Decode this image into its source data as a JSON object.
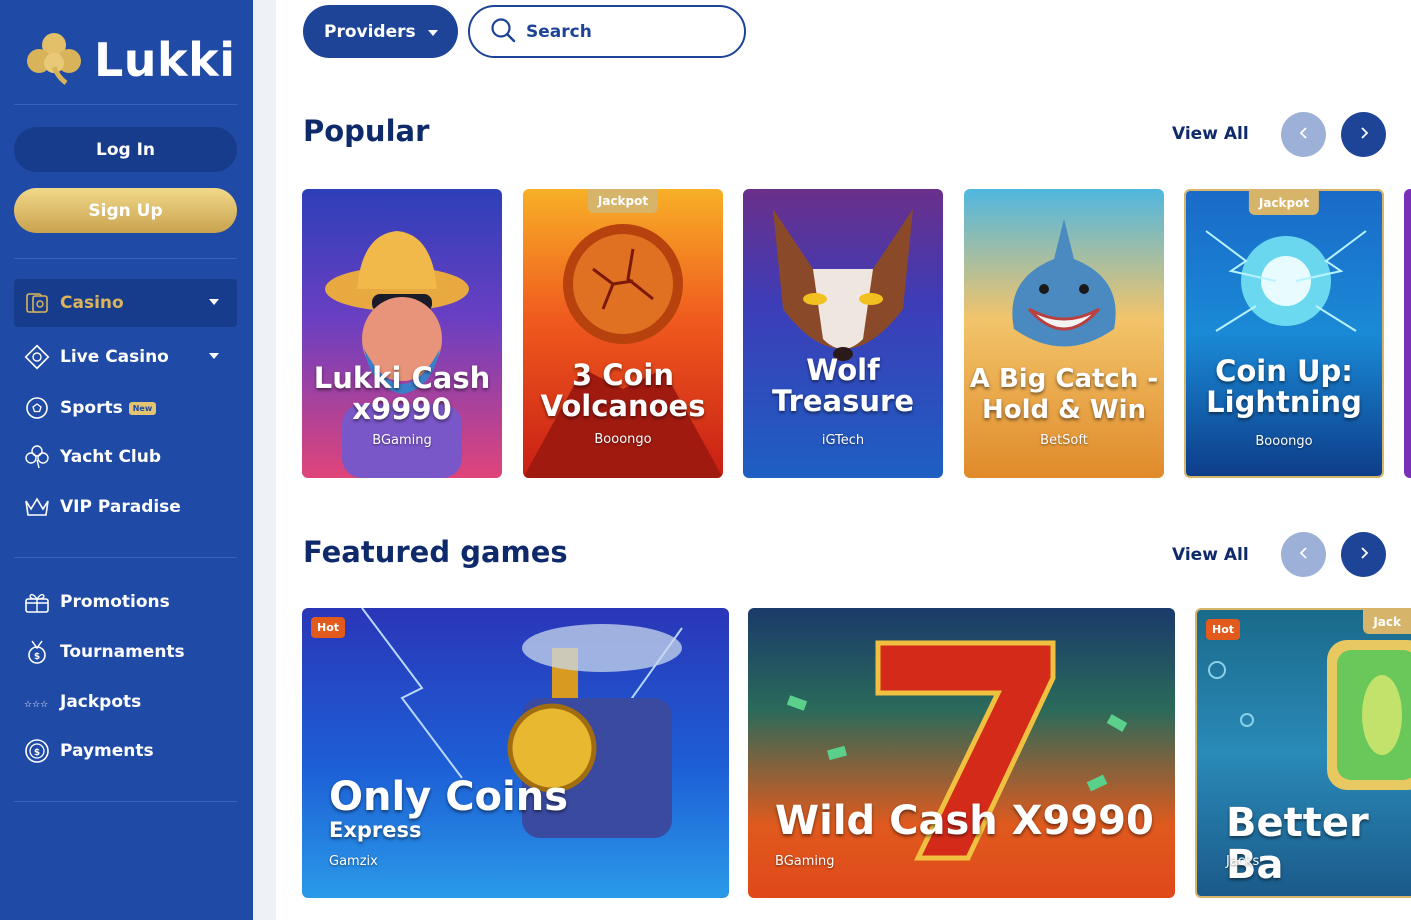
{
  "brand": {
    "name": "Lukki"
  },
  "auth": {
    "login_label": "Log In",
    "signup_label": "Sign Up"
  },
  "sidebar": {
    "primary": [
      {
        "label": "Casino",
        "icon": "cards-icon"
      },
      {
        "label": "Live Casino",
        "icon": "diamond-chip-icon"
      },
      {
        "label": "Sports",
        "icon": "soccer-ball-icon",
        "badge": "New"
      },
      {
        "label": "Yacht Club",
        "icon": "clover-outline-icon"
      },
      {
        "label": "VIP Paradise",
        "icon": "crown-icon"
      }
    ],
    "secondary": [
      {
        "label": "Promotions",
        "icon": "gift-icon"
      },
      {
        "label": "Tournaments",
        "icon": "medal-icon"
      },
      {
        "label": "Jackpots",
        "icon": "stars-icon"
      },
      {
        "label": "Payments",
        "icon": "coin-icon"
      }
    ]
  },
  "toolbar": {
    "providers_label": "Providers",
    "search_placeholder": "Search"
  },
  "popular": {
    "title": "Popular",
    "view_all": "View All",
    "games": [
      {
        "title": "Lukki Cash x9990",
        "provider": "BGaming",
        "tag": ""
      },
      {
        "title": "3 Coin Volcanoes",
        "provider": "Booongo",
        "tag": "Jackpot"
      },
      {
        "title": "Wolf Treasure",
        "provider": "iGTech",
        "tag": ""
      },
      {
        "title": "A Big Catch - Hold & Win",
        "provider": "BetSoft",
        "tag": ""
      },
      {
        "title": "Coin Up: Lightning",
        "provider": "Booongo",
        "tag": "Jackpot"
      }
    ]
  },
  "featured": {
    "title": "Featured games",
    "view_all": "View All",
    "games": [
      {
        "title": "Only Coins",
        "subtitle": "Express",
        "provider": "Gamzix",
        "tag": "Hot"
      },
      {
        "title": "Wild Cash X9990",
        "provider": "BGaming",
        "tag": ""
      },
      {
        "title": "Better Ba",
        "provider": "Jacks",
        "tag": "Hot",
        "tag2": "Jack"
      }
    ]
  },
  "colors": {
    "sidebar": "#1f4aa6",
    "accent_gold": "#d6b46a",
    "primary_dark": "#0f2a6b"
  }
}
